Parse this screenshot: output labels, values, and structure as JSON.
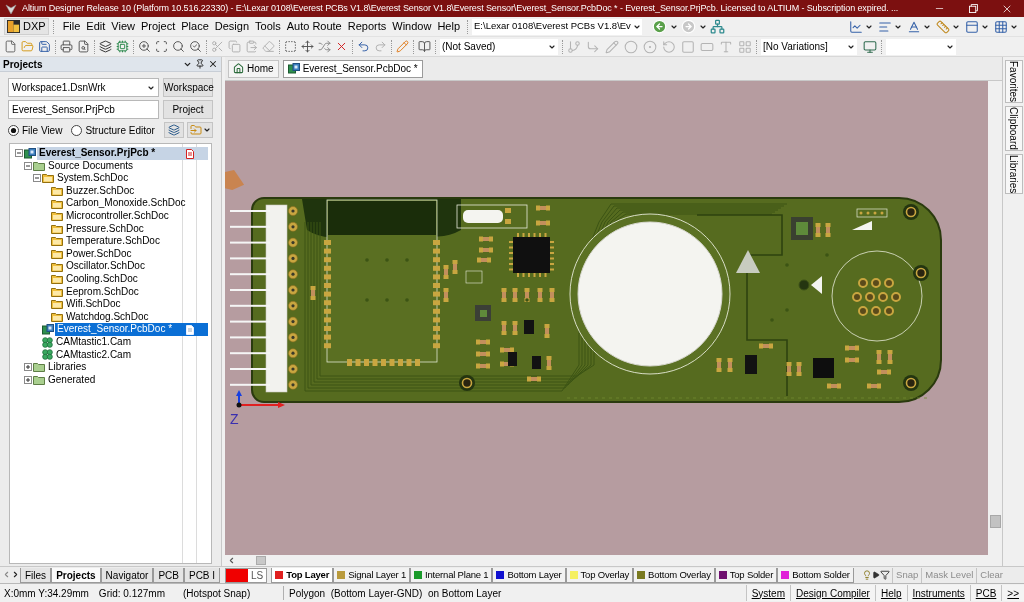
{
  "window": {
    "title": "Altium Designer Release 10 (Platform 10.516.22330) - E:\\Lexar 0108\\Everest PCBs V1.8\\Everest Sensor V1.8\\Everest Sensor\\Everest_Sensor.PcbDoc * - Everest_Sensor.PrjPcb. Licensed to ALTIUM - Subscription expired. ..."
  },
  "menu": {
    "dxp": "DXP",
    "items": [
      "File",
      "Edit",
      "View",
      "Project",
      "Place",
      "Design",
      "Tools",
      "Auto Route",
      "Reports",
      "Window",
      "Help"
    ],
    "path": "E:\\Lexar 0108\\Everest PCBs V1.8\\Ev"
  },
  "toolbar": {
    "document_state": "(Not Saved)",
    "variations": "[No Variations]"
  },
  "projects_panel": {
    "title": "Projects",
    "workspace": "Workspace1.DsnWrk",
    "workspace_button": "Workspace",
    "project": "Everest_Sensor.PrjPcb",
    "project_button": "Project",
    "views": [
      {
        "label": "File View",
        "selected": true
      },
      {
        "label": "Structure Editor",
        "selected": false
      }
    ],
    "tree": [
      {
        "label": "Everest_Sensor.PrjPcb *",
        "kind": "project",
        "expanded": true,
        "selected": false,
        "modified": true,
        "children": [
          {
            "label": "Source Documents",
            "kind": "folder",
            "expanded": true,
            "selected": false,
            "modified": false,
            "children": [
              {
                "label": "System.SchDoc",
                "kind": "schematic",
                "expanded": true,
                "selected": false,
                "modified": false,
                "children": [
                  {
                    "label": "Buzzer.SchDoc",
                    "kind": "schematic",
                    "selected": false,
                    "modified": false
                  },
                  {
                    "label": "Carbon_Monoxide.SchDoc",
                    "kind": "schematic",
                    "selected": false,
                    "modified": false
                  },
                  {
                    "label": "Microcontroller.SchDoc",
                    "kind": "schematic",
                    "selected": false,
                    "modified": false
                  },
                  {
                    "label": "Pressure.SchDoc",
                    "kind": "schematic",
                    "selected": false,
                    "modified": false
                  },
                  {
                    "label": "Temperature.SchDoc",
                    "kind": "schematic",
                    "selected": false,
                    "modified": false
                  },
                  {
                    "label": "Power.SchDoc",
                    "kind": "schematic",
                    "selected": false,
                    "modified": false
                  },
                  {
                    "label": "Oscillator.SchDoc",
                    "kind": "schematic",
                    "selected": false,
                    "modified": false
                  },
                  {
                    "label": "Cooling.SchDoc",
                    "kind": "schematic",
                    "selected": false,
                    "modified": false
                  },
                  {
                    "label": "Eeprom.SchDoc",
                    "kind": "schematic",
                    "selected": false,
                    "modified": false
                  },
                  {
                    "label": "Wifi.SchDoc",
                    "kind": "schematic",
                    "selected": false,
                    "modified": false
                  },
                  {
                    "label": "Watchdog.SchDoc",
                    "kind": "schematic",
                    "selected": false,
                    "modified": false
                  }
                ]
              },
              {
                "label": "Everest_Sensor.PcbDoc *",
                "kind": "pcb",
                "selected": true,
                "modified": true
              },
              {
                "label": "CAMtastic1.Cam",
                "kind": "cam",
                "selected": false,
                "modified": false
              },
              {
                "label": "CAMtastic2.Cam",
                "kind": "cam",
                "selected": false,
                "modified": false
              }
            ]
          },
          {
            "label": "Libraries",
            "kind": "folder",
            "expanded": false,
            "selected": false,
            "modified": false
          },
          {
            "label": "Generated",
            "kind": "folder",
            "expanded": false,
            "selected": false,
            "modified": false
          }
        ]
      }
    ]
  },
  "document_tabs": {
    "home": "Home",
    "tabs": [
      {
        "label": "Everest_Sensor.PcbDoc *",
        "selected": true
      }
    ]
  },
  "canvas": {
    "axis_label": "Z"
  },
  "side_tabs": [
    "Favorites",
    "Clipboard",
    "Libraries"
  ],
  "panel_tabs": [
    {
      "label": "Files",
      "selected": false
    },
    {
      "label": "Projects",
      "selected": true
    },
    {
      "label": "Navigator",
      "selected": false
    },
    {
      "label": "PCB",
      "selected": false
    },
    {
      "label": "PCB I",
      "selected": false
    }
  ],
  "layer_bar": {
    "current": {
      "color": "#f00000",
      "label": "LS"
    },
    "layers": [
      {
        "name": "Top Layer",
        "color": "#e01f1f",
        "selected": true
      },
      {
        "name": "Signal Layer 1",
        "color": "#b99a3c",
        "selected": false
      },
      {
        "name": "Internal Plane 1",
        "color": "#1a9a2a",
        "selected": false
      },
      {
        "name": "Bottom Layer",
        "color": "#1010d0",
        "selected": false
      },
      {
        "name": "Top Overlay",
        "color": "#f5f060",
        "selected": false
      },
      {
        "name": "Bottom Overlay",
        "color": "#7a7a20",
        "selected": false
      },
      {
        "name": "Top Solder",
        "color": "#701070",
        "selected": false
      },
      {
        "name": "Bottom Solder",
        "color": "#e020d8",
        "selected": false
      }
    ],
    "buttons": [
      {
        "label": "Snap",
        "disabled": true
      },
      {
        "label": "Mask Level",
        "disabled": true
      },
      {
        "label": "Clear",
        "disabled": true
      }
    ]
  },
  "status_bar": {
    "position": "X:0mm Y:34.29mm",
    "grid": "Grid: 0.127mm",
    "snap": "(Hotspot Snap)",
    "message": "Polygon  (Bottom Layer-GND)  on Bottom Layer",
    "buttons": [
      "System",
      "Design Compiler",
      "Help",
      "Instruments",
      "PCB",
      ">>"
    ]
  }
}
